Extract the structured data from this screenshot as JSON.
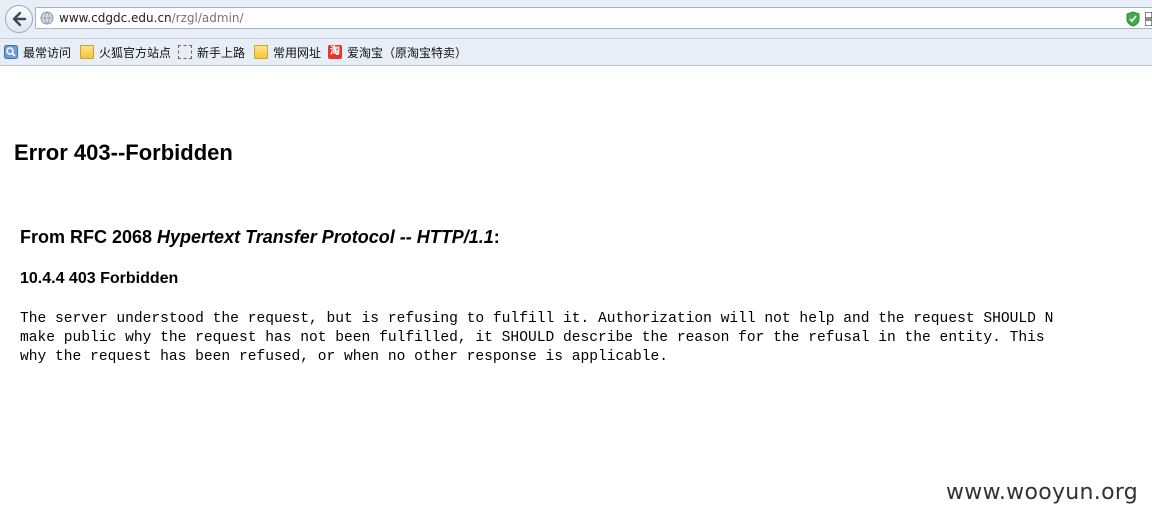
{
  "browser": {
    "url_host": "www.cdgdc.edu.cn",
    "url_path": "/rzgl/admin/",
    "icons": [
      "back-arrow-icon",
      "globe-icon",
      "shield-icon",
      "qr-code-icon"
    ],
    "bookmarks": [
      {
        "label": "最常访问",
        "icon": "most-visited-icon"
      },
      {
        "label": "火狐官方站点",
        "icon": "folder-icon"
      },
      {
        "label": "新手上路",
        "icon": "dotted-page-icon"
      },
      {
        "label": "常用网址",
        "icon": "folder-icon"
      },
      {
        "label": "爱淘宝（原淘宝特卖）",
        "icon": "taobao-icon",
        "icon_text": "淘"
      }
    ]
  },
  "page": {
    "title": "Error 403--Forbidden",
    "rfc_prefix": "From RFC 2068 ",
    "rfc_title": "Hypertext Transfer Protocol -- HTTP/1.1",
    "rfc_suffix": ":",
    "section": "10.4.4 403 Forbidden",
    "body_lines": [
      "The server understood the request, but is refusing to fulfill it. Authorization will not help and the request SHOULD N",
      "make public why the request has not been fulfilled, it SHOULD describe the reason for the refusal in the entity. This",
      "why the request has been refused, or when no other response is applicable."
    ]
  },
  "watermark": "www.wooyun.org"
}
